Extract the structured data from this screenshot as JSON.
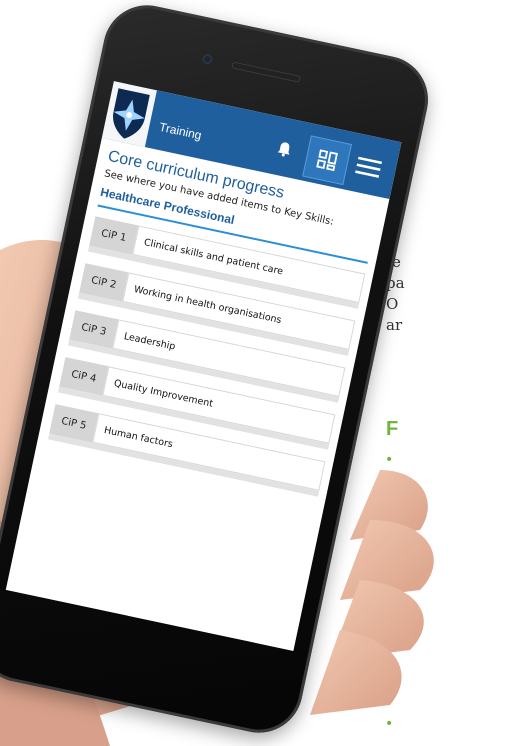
{
  "background": {
    "lines": [
      "te",
      "pa",
      "O",
      "ar"
    ],
    "heading": "F"
  },
  "app": {
    "title": "Training",
    "icons": [
      "bell-icon",
      "dashboard-icon",
      "menu-icon"
    ]
  },
  "page": {
    "title": "Core curriculum progress",
    "subtitle": "See where you have added items to Key Skills:",
    "section": "Healthcare Professional",
    "items": [
      {
        "code": "CiP 1",
        "label": "Clinical skills and patient care"
      },
      {
        "code": "CiP 2",
        "label": "Working in health organisations"
      },
      {
        "code": "CiP 3",
        "label": "Leadership"
      },
      {
        "code": "CiP 4",
        "label": "Quality Improvement"
      },
      {
        "code": "CiP 5",
        "label": "Human factors"
      }
    ]
  },
  "colors": {
    "accent": "#1f5f9e",
    "section_rule": "#2b8fd6",
    "bg_heading": "#6fb43f"
  }
}
